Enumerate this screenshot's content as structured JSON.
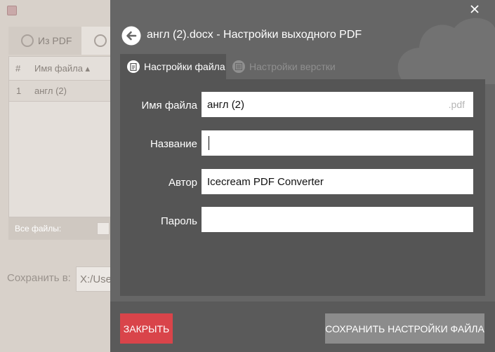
{
  "background_app": {
    "tabs": [
      {
        "label": "Из PDF"
      },
      {
        "label": ""
      }
    ],
    "table": {
      "columns": [
        "#",
        "Имя файла"
      ],
      "rows": [
        {
          "index": "1",
          "name": "англ (2)"
        }
      ]
    },
    "all_files_label": "Все файлы:",
    "save_to": {
      "label": "Сохранить в:",
      "value": "X:/Use"
    }
  },
  "dialog": {
    "title": "англ (2).docx - Настройки выходного PDF",
    "tabs": [
      {
        "label": "Настройки файла",
        "active": true,
        "icon": "document-icon"
      },
      {
        "label": "Настройки верстки",
        "active": false,
        "icon": "layout-icon"
      }
    ],
    "fields": {
      "filename": {
        "label": "Имя файла",
        "value": "англ (2)",
        "suffix": ".pdf"
      },
      "name": {
        "label": "Название",
        "value": ""
      },
      "author": {
        "label": "Автор",
        "value": "Icecream PDF Converter"
      },
      "password": {
        "label": "Пароль",
        "value": ""
      }
    },
    "buttons": {
      "close": "ЗАКРЫТЬ",
      "save": "СОХРАНИТЬ НАСТРОЙКИ ФАЙЛА"
    }
  },
  "colors": {
    "dialog_bg": "#666666",
    "panel_bg": "#555555",
    "close_button": "#d9444a",
    "save_button": "#8c8c8c"
  }
}
